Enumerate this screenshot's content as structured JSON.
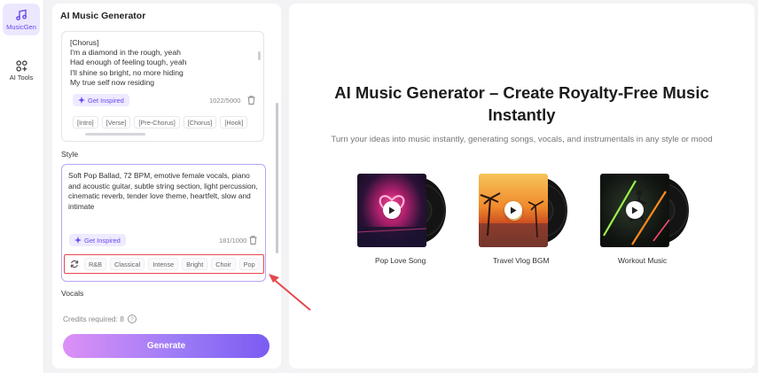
{
  "rail": {
    "items": [
      {
        "label": "MusicGen",
        "icon": "music-note-icon",
        "active": true
      },
      {
        "label": "AI Tools",
        "icon": "tools-grid-icon",
        "active": false
      }
    ]
  },
  "panel": {
    "title": "AI Music Generator",
    "lyrics": {
      "lines": [
        "[Chorus]",
        "I'm a diamond in the rough, yeah",
        "Had enough of feeling tough, yeah",
        "I'll shine so bright, no more hiding",
        "My true self now residing"
      ],
      "inspire_label": "Get Inspired",
      "count": "1022/5000",
      "tags": [
        "[Intro]",
        "[Verse]",
        "[Pre-Chorus]",
        "[Chorus]",
        "[Hook]"
      ]
    },
    "style": {
      "label": "Style",
      "text": "Soft Pop Ballad, 72 BPM, emotive female vocals, piano and acoustic guitar, subtle string section, light percussion, cinematic reverb, tender love theme, heartfelt, slow and intimate",
      "inspire_label": "Get Inspired",
      "count": "181/1000",
      "tags": [
        "R&B",
        "Classical",
        "Intense",
        "Bright",
        "Choir",
        "Pop"
      ]
    },
    "vocals_label": "Vocals",
    "credits_label": "Credits required: 8",
    "generate_label": "Generate"
  },
  "main": {
    "title_line1": "AI Music Generator – Create Royalty-Free Music",
    "title_line2": "Instantly",
    "subtitle": "Turn your ideas into music instantly, generating songs, vocals, and instrumentals in any style or mood",
    "cards": [
      {
        "label": "Pop Love Song"
      },
      {
        "label": "Travel Vlog BGM"
      },
      {
        "label": "Workout Music"
      }
    ]
  },
  "colors": {
    "accent": "#6b48ef",
    "highlight_box": "#e5484d",
    "generate_start": "#dd90f6",
    "generate_end": "#7b5cf2"
  }
}
